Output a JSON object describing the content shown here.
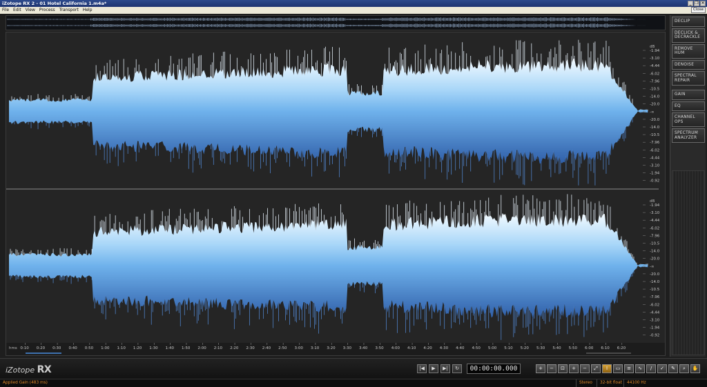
{
  "window": {
    "title": "iZotope RX 2 - 01 Hotel California 1.m4a*",
    "buttons": [
      "_",
      "❐",
      "✕"
    ]
  },
  "menu": {
    "items": [
      "File",
      "Edit",
      "View",
      "Process",
      "Transport",
      "Help"
    ],
    "close_label": "Close"
  },
  "db_scale": {
    "unit": "dB",
    "labels": [
      "-1.94",
      "-3.10",
      "-4.44",
      "-6.02",
      "-7.96",
      "-10.5",
      "-14.0",
      "-20.0",
      "-∞",
      "-20.0",
      "-14.0",
      "-10.5",
      "-7.96",
      "-6.02",
      "-4.44",
      "-3.10",
      "-1.94",
      "-0.92"
    ]
  },
  "timeline": {
    "unit_label": "hms",
    "ticks": [
      "0:10",
      "0:20",
      "0:30",
      "0:40",
      "0:50",
      "1:00",
      "1:10",
      "1:20",
      "1:30",
      "1:40",
      "1:50",
      "2:00",
      "2:10",
      "2:20",
      "2:30",
      "2:40",
      "2:50",
      "3:00",
      "3:10",
      "3:20",
      "3:30",
      "3:40",
      "3:50",
      "4:00",
      "4:10",
      "4:20",
      "4:30",
      "4:40",
      "4:50",
      "5:00",
      "5:10",
      "5:20",
      "5:30",
      "5:40",
      "5:50",
      "6:00",
      "6:10",
      "6:20"
    ]
  },
  "modules": [
    {
      "label": "DECLIP"
    },
    {
      "label": "DECLICK &\nDECRACKLE"
    },
    {
      "label": "REMOVE\nHUM"
    },
    {
      "label": "DENOISE"
    },
    {
      "label": "SPECTRAL\nREPAIR"
    },
    {
      "label": "GAIN"
    },
    {
      "label": "EQ"
    },
    {
      "label": "CHANNEL\nOPS"
    },
    {
      "label": "SPECTRUM\nANALYZER"
    }
  ],
  "logo": {
    "brand": "iZotope",
    "product": "RX"
  },
  "transport": {
    "buttons": [
      {
        "icon": "skip-to-start-icon",
        "glyph": "|◀"
      },
      {
        "icon": "play-icon",
        "glyph": "▶"
      },
      {
        "icon": "play-selection-icon",
        "glyph": "▶|"
      },
      {
        "icon": "loop-icon",
        "glyph": "↻"
      }
    ],
    "timecode": "00:00:00.000"
  },
  "tools": [
    {
      "icon": "zoom-in-icon",
      "glyph": "+"
    },
    {
      "icon": "zoom-out-icon",
      "glyph": "−"
    },
    {
      "icon": "zoom-selection-icon",
      "glyph": "⊡"
    },
    {
      "icon": "zoom-in-h-icon",
      "glyph": "+"
    },
    {
      "icon": "zoom-out-h-icon",
      "glyph": "−"
    },
    {
      "icon": "zoom-full-icon",
      "glyph": "⤢"
    },
    {
      "icon": "time-select-icon",
      "glyph": "I",
      "active": true
    },
    {
      "icon": "rect-select-icon",
      "glyph": "▭"
    },
    {
      "icon": "freq-select-icon",
      "glyph": "≡"
    },
    {
      "icon": "lasso-icon",
      "glyph": "∿"
    },
    {
      "icon": "brush-icon",
      "glyph": "/"
    },
    {
      "icon": "wand-icon",
      "glyph": "✓"
    },
    {
      "icon": "pencil-icon",
      "glyph": "✎"
    },
    {
      "icon": "magnify-icon",
      "glyph": "⌕"
    },
    {
      "icon": "hand-icon",
      "glyph": "✋"
    }
  ],
  "status": {
    "message": "Applied Gain (483 ms)",
    "channels": "Stereo",
    "format": "32-bit float",
    "sample_rate": "44100 Hz"
  },
  "colors": {
    "wave_top": "#e8f4ff",
    "wave_mid": "#8cc8f4",
    "wave_bottom": "#3d6fb8",
    "accent_orange": "#e08a2a"
  }
}
